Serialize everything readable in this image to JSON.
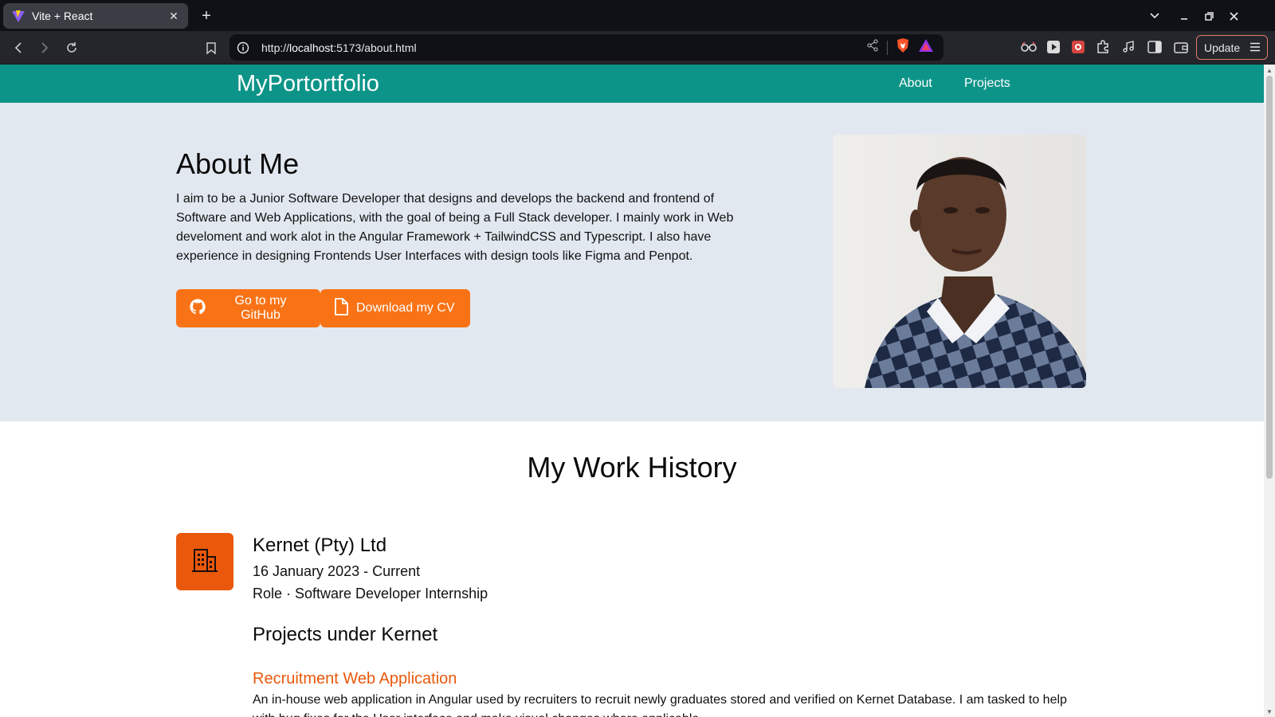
{
  "browser": {
    "tab_title": "Vite + React",
    "url_scheme": "http://",
    "url_host": "localhost",
    "url_rest": ":5173/about.html",
    "update_label": "Update"
  },
  "site": {
    "brand": "MyPortortfolio",
    "nav": [
      "About",
      "Projects"
    ]
  },
  "hero": {
    "heading": "About Me",
    "bio": "I aim to be a Junior Software Developer that designs and develops the backend and frontend of Software and Web Applications, with the goal of being a Full Stack developer. I mainly work in Web develoment and work alot in the Angular Framework + TailwindCSS and Typescript. I also have experience in designing Frontends User Interfaces with design tools like Figma and Penpot.",
    "github_label": "Go to my GitHub",
    "cv_label": "Download my CV"
  },
  "work": {
    "heading": "My Work History",
    "company": "Kernet (Pty) Ltd",
    "dates": "16 January 2023 - Current",
    "role": "Role · Software Developer Internship",
    "projects_heading": "Projects under Kernet",
    "project_title": "Recruitment Web Application",
    "project_desc": "An in-house web application in Angular used by recruiters to recruit newly graduates stored and verified on Kernet Database. I am tasked to help with bug fixes for the User interface and make visual changes where applicable."
  },
  "colors": {
    "nav_bg": "#0d9488",
    "hero_bg": "#e2e8f0",
    "button_bg": "#f97316",
    "accent": "#ea580c"
  },
  "icons": [
    "vite-favicon",
    "github-icon",
    "file-icon",
    "building-icon",
    "info-icon",
    "share-icon",
    "brave-shield-icon",
    "rewards-icon",
    "bookmark-icon"
  ]
}
